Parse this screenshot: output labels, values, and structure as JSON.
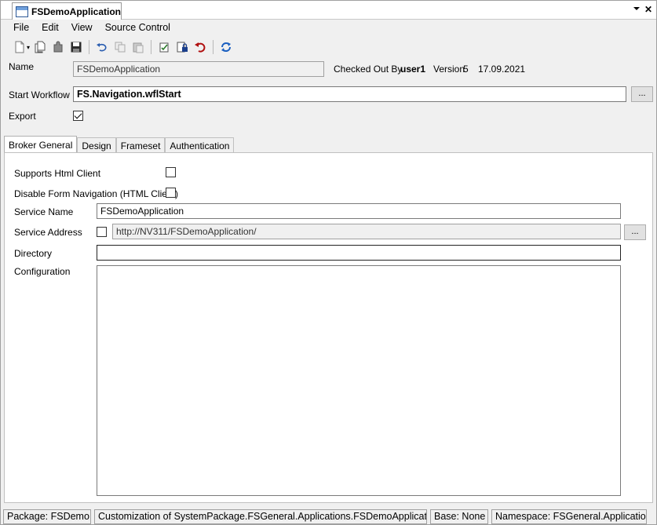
{
  "document_tab": {
    "title": "FSDemoApplication",
    "dropdown_icon": "chevron-down-icon",
    "close_icon": "close-icon"
  },
  "menu": {
    "items": [
      "File",
      "Edit",
      "View",
      "Source Control"
    ]
  },
  "toolbar": {
    "buttons": [
      "new-icon",
      "copy-document-icon",
      "plugin-icon",
      "save-icon",
      "undo-icon",
      "copy-icon",
      "paste-icon",
      "check-in-icon",
      "check-out-lock-icon",
      "undo-checkout-icon",
      "refresh-icon"
    ]
  },
  "form": {
    "name_label": "Name",
    "name_value": "FSDemoApplication",
    "checked_out_by_label": "Checked Out By",
    "checked_out_by_value": "user1",
    "version_label": "Version",
    "version_value": "5",
    "date_value": "17.09.2021",
    "start_workflow_label": "Start Workflow",
    "start_workflow_value": "FS.Navigation.wflStart",
    "browse_label": "...",
    "export_label": "Export",
    "export_checked": true
  },
  "tabs": [
    "Broker General",
    "Design",
    "Frameset",
    "Authentication"
  ],
  "active_tab": "Broker General",
  "broker_general": {
    "supports_html_client_label": "Supports Html Client",
    "supports_html_client_checked": false,
    "disable_form_navigation_label": "Disable Form Navigation (HTML Client)",
    "disable_form_navigation_checked": false,
    "service_name_label": "Service Name",
    "service_name_value": "FSDemoApplication",
    "service_address_label": "Service Address",
    "service_address_checked": false,
    "service_address_value": "http://NV311/FSDemoApplication/",
    "service_address_browse_label": "...",
    "directory_label": "Directory",
    "directory_value": "",
    "configuration_label": "Configuration",
    "configuration_value": ""
  },
  "statusbar": {
    "package": "Package: FSDemo",
    "customization": "Customization of SystemPackage.FSGeneral.Applications.FSDemoApplication",
    "base": "Base: None",
    "namespace": "Namespace: FSGeneral.Applications"
  }
}
